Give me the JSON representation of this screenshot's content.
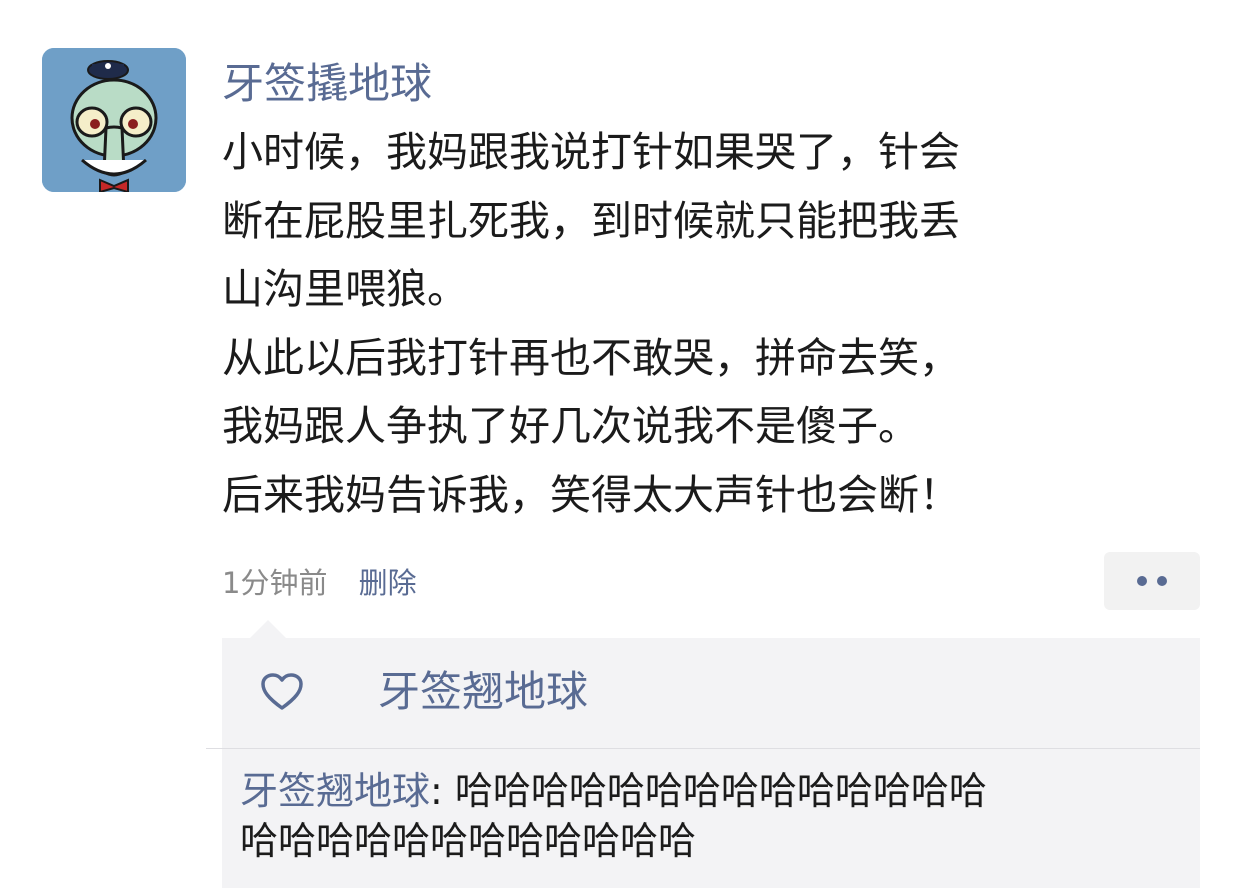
{
  "post": {
    "author": "牙签撬地球",
    "avatar_icon": "squidward-avatar-icon",
    "content_lines": [
      "小时候，我妈跟我说打针如果哭了，针会",
      "断在屁股里扎死我，到时候就只能把我丢",
      "山沟里喂狼。",
      "从此以后我打针再也不敢哭，拼命去笑，",
      "我妈跟人争执了好几次说我不是傻子。",
      "后来我妈告诉我，笑得太大声针也会断！"
    ],
    "timestamp": "1分钟前",
    "delete_label": "删除",
    "more_icon": "more-dots-icon"
  },
  "likes": {
    "icon": "heart-icon",
    "names": "牙签翘地球"
  },
  "comments": [
    {
      "name": "牙签翘地球",
      "separator": ": ",
      "text_line1": "哈哈哈哈哈哈哈哈哈哈哈哈哈哈",
      "text_line2": "哈哈哈哈哈哈哈哈哈哈哈哈"
    }
  ],
  "colors": {
    "link": "#596b93",
    "panel_bg": "#f3f3f5",
    "meta_text": "#8a8a8a",
    "avatar_bg": "#6f9fc7"
  }
}
